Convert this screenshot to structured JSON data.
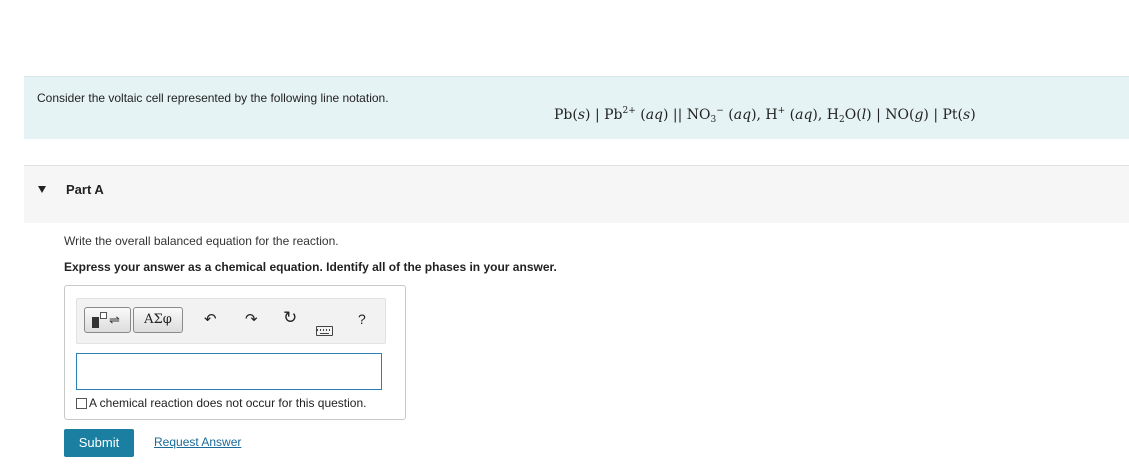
{
  "problem": {
    "intro": "Consider the voltaic cell represented by the following line notation.",
    "notation": {
      "pb1": "Pb(",
      "s1": "s",
      "close1": ") | Pb",
      "charge_pb": "2+",
      "aq1_open": " (",
      "aq1": "aq",
      "sep_bridge": ") || NO",
      "sub_no3": "3",
      "charge_no3": "−",
      "aq2_open": " (",
      "aq2": "aq",
      "h_part": "), H",
      "charge_h": "+",
      "aq3_open": " (",
      "aq3": "aq",
      "h2o_part": "), H",
      "sub_h2": "2",
      "o_part": "O(",
      "l": "l",
      "no_part": ") | NO(",
      "g": "g",
      "pt_part": ") | Pt(",
      "s2": "s",
      "end": ")"
    }
  },
  "part": {
    "label": "Part A",
    "instruction": "Write the overall balanced equation for the reaction.",
    "emphasis": "Express your answer as a chemical equation. Identify all of the phases in your answer."
  },
  "toolbar": {
    "symbols_label": "ΑΣφ",
    "templates_arrows": "⇌",
    "undo_glyph": "↶",
    "redo_glyph": "↷",
    "reset_glyph": "↻",
    "help_label": "?"
  },
  "answer": {
    "value": "",
    "no_reaction_label": "A chemical reaction does not occur for this question.",
    "no_reaction_checked": false
  },
  "actions": {
    "submit_label": "Submit",
    "request_label": "Request Answer"
  },
  "colors": {
    "intro_bg": "#e6f3f4",
    "part_bg": "#f6f6f6",
    "submit_bg": "#1a7fa1",
    "link": "#1a6a9a",
    "input_border": "#2d7fb8"
  },
  "icons": [
    "collapse-triangle-icon",
    "templates-icon",
    "undo-icon",
    "redo-icon",
    "reset-icon",
    "keyboard-icon",
    "help-icon"
  ]
}
